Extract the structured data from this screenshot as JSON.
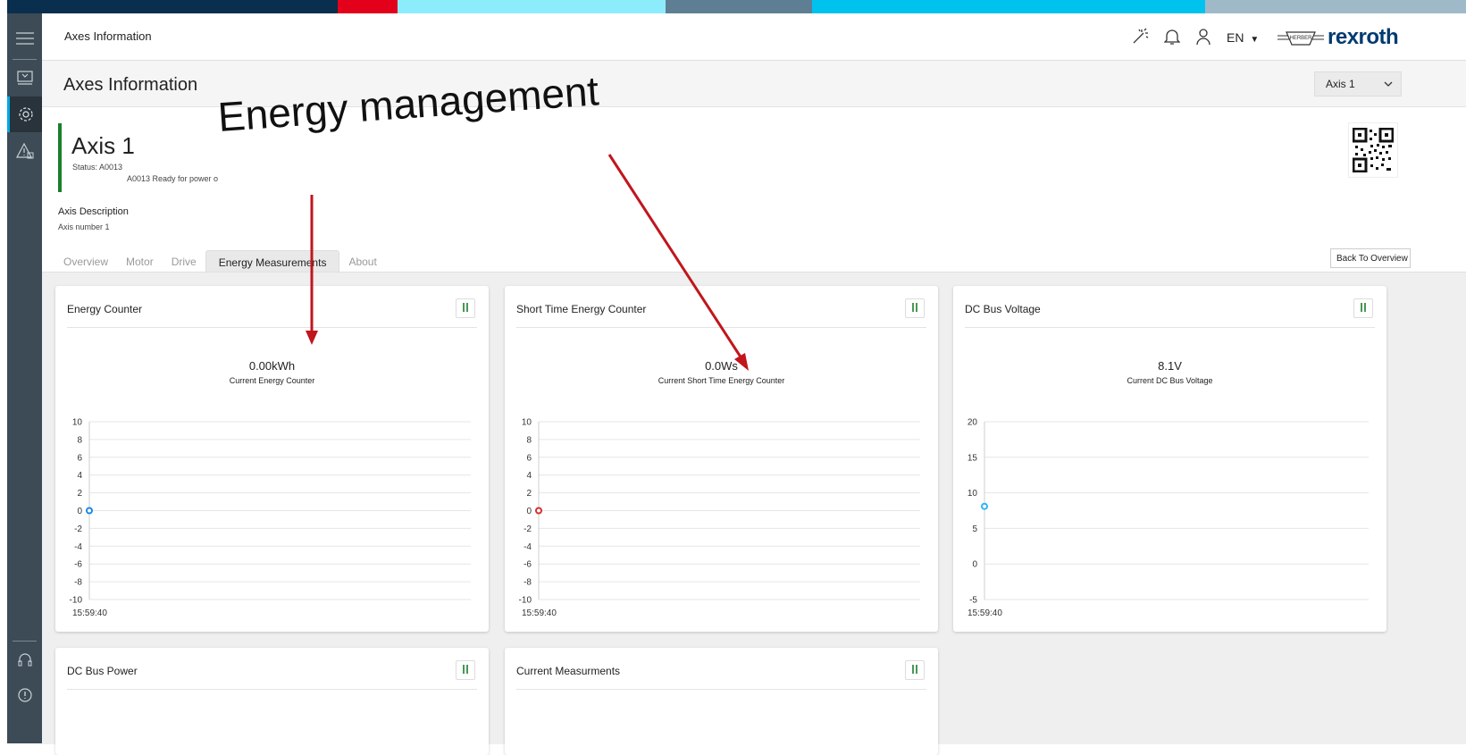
{
  "window": {
    "brand_colors": [
      "#0a2f4e",
      "#e2001a",
      "#8cecfb",
      "#5e7f93",
      "#00c2ef",
      "#9fb9c9"
    ]
  },
  "header": {
    "title": "Axes Information",
    "language": "EN",
    "logo_badge": "HERBER",
    "logo_text": "rexroth",
    "icons": [
      "wand-icon",
      "bell-icon",
      "user-icon"
    ]
  },
  "subheader": {
    "title": "Axes Information",
    "axis_selector": "Axis 1"
  },
  "axis": {
    "name": "Axis 1",
    "status_label": "Status:",
    "status_code": "A0013",
    "status_text": "A0013 Ready for power o",
    "description_label": "Axis Description",
    "description_value": "Axis number 1",
    "accent_color": "#1a7f2a"
  },
  "tabs": [
    "Overview",
    "Motor",
    "Drive",
    "Energy Measurements",
    "About"
  ],
  "active_tab": "Energy Measurements",
  "back_button": "Back To Overview",
  "annotation": {
    "text": "Energy management",
    "color": "#c0161c"
  },
  "cards": [
    {
      "title": "Energy Counter",
      "value": "0.00kWh",
      "caption": "Current Energy Counter"
    },
    {
      "title": "Short Time Energy Counter",
      "value": "0.0Ws",
      "caption": "Current Short Time Energy Counter"
    },
    {
      "title": "DC Bus Voltage",
      "value": "8.1V",
      "caption": "Current DC Bus Voltage"
    },
    {
      "title": "DC Bus Power"
    },
    {
      "title": "Current Measurments"
    }
  ],
  "chart_data": [
    {
      "type": "line",
      "title": "Energy Counter",
      "x": [
        "15:59:40"
      ],
      "series": [
        {
          "values": [
            0
          ],
          "color": "#1e88e5"
        }
      ],
      "yticks": [
        10,
        8,
        6,
        4,
        2,
        0,
        -2,
        -4,
        -6,
        -8,
        -10
      ],
      "ylim": [
        -10,
        10
      ],
      "grid": true
    },
    {
      "type": "line",
      "title": "Short Time Energy Counter",
      "x": [
        "15:59:40"
      ],
      "series": [
        {
          "values": [
            0
          ],
          "color": "#d32f2f"
        }
      ],
      "yticks": [
        10,
        8,
        6,
        4,
        2,
        0,
        -2,
        -4,
        -6,
        -8,
        -10
      ],
      "ylim": [
        -10,
        10
      ],
      "grid": true
    },
    {
      "type": "line",
      "title": "DC Bus Voltage",
      "x": [
        "15:59:40"
      ],
      "series": [
        {
          "values": [
            8.1
          ],
          "color": "#29b6f6"
        }
      ],
      "yticks": [
        20,
        15,
        10,
        5,
        0,
        -5
      ],
      "ylim": [
        -5,
        20
      ],
      "grid": true
    }
  ]
}
